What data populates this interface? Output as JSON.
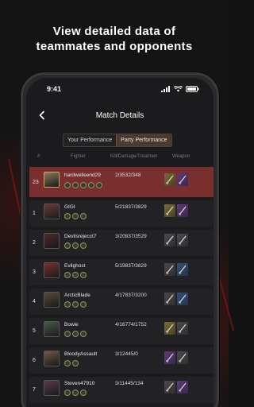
{
  "headline": {
    "line1": "View detailed data of",
    "line2": "teammates and opponents"
  },
  "status_bar": {
    "time": "9:41"
  },
  "nav": {
    "title": "Match Details",
    "back_icon": "chevron-left-icon"
  },
  "tabs": [
    {
      "label": "Your Performance",
      "active": false
    },
    {
      "label": "Party Performance",
      "active": true
    }
  ],
  "table_headers": {
    "rank": "#",
    "fighter": "Fighter",
    "stats": "Kill/Damage/Treatmen",
    "weapon": "Weapon"
  },
  "rows": [
    {
      "rank": "23",
      "name": "hardwelleend29",
      "stats": "2/3532/348",
      "highlight": true,
      "badge_count": 5,
      "avatar_color": "#8a7a5a",
      "weapons": [
        "gold",
        "purple"
      ]
    },
    {
      "rank": "1",
      "name": "GIGI",
      "stats": "5/21837/3829",
      "highlight": false,
      "badge_count": 3,
      "avatar_color": "#6a3a3a",
      "weapons": [
        "gold",
        "purple"
      ]
    },
    {
      "rank": "2",
      "name": "Devilsrejecct7",
      "stats": "3/20837/3529",
      "highlight": false,
      "badge_count": 3,
      "avatar_color": "#4a2a2a",
      "weapons": [
        "gray",
        "gray"
      ]
    },
    {
      "rank": "3",
      "name": "Evilghost",
      "stats": "5/19837/3829",
      "highlight": false,
      "badge_count": 3,
      "avatar_color": "#7a3030",
      "weapons": [
        "gray",
        "blue"
      ]
    },
    {
      "rank": "4",
      "name": "ArcticBlade",
      "stats": "4/17837/3200",
      "highlight": false,
      "badge_count": 3,
      "avatar_color": "#5a4a3a",
      "weapons": [
        "gray",
        "blue"
      ]
    },
    {
      "rank": "5",
      "name": "Bowie",
      "stats": "4/16774/1752",
      "highlight": false,
      "badge_count": 3,
      "avatar_color": "#4a5a4a",
      "weapons": [
        "gold",
        "gray"
      ]
    },
    {
      "rank": "6",
      "name": "BloodyAssault",
      "stats": "3/12445/0",
      "highlight": false,
      "badge_count": 2,
      "avatar_color": "#6a5a4a",
      "weapons": [
        "purple",
        "gray"
      ]
    },
    {
      "rank": "7",
      "name": "Steven47910",
      "stats": "3/11445/134",
      "highlight": false,
      "badge_count": 3,
      "avatar_color": "#5a3a4a",
      "weapons": [
        "gray",
        "purple"
      ]
    }
  ],
  "colors": {
    "highlight_row": "#7a2f2f",
    "row_bg": "#222225",
    "active_tab": "#4a3b30",
    "background": "#141414"
  }
}
